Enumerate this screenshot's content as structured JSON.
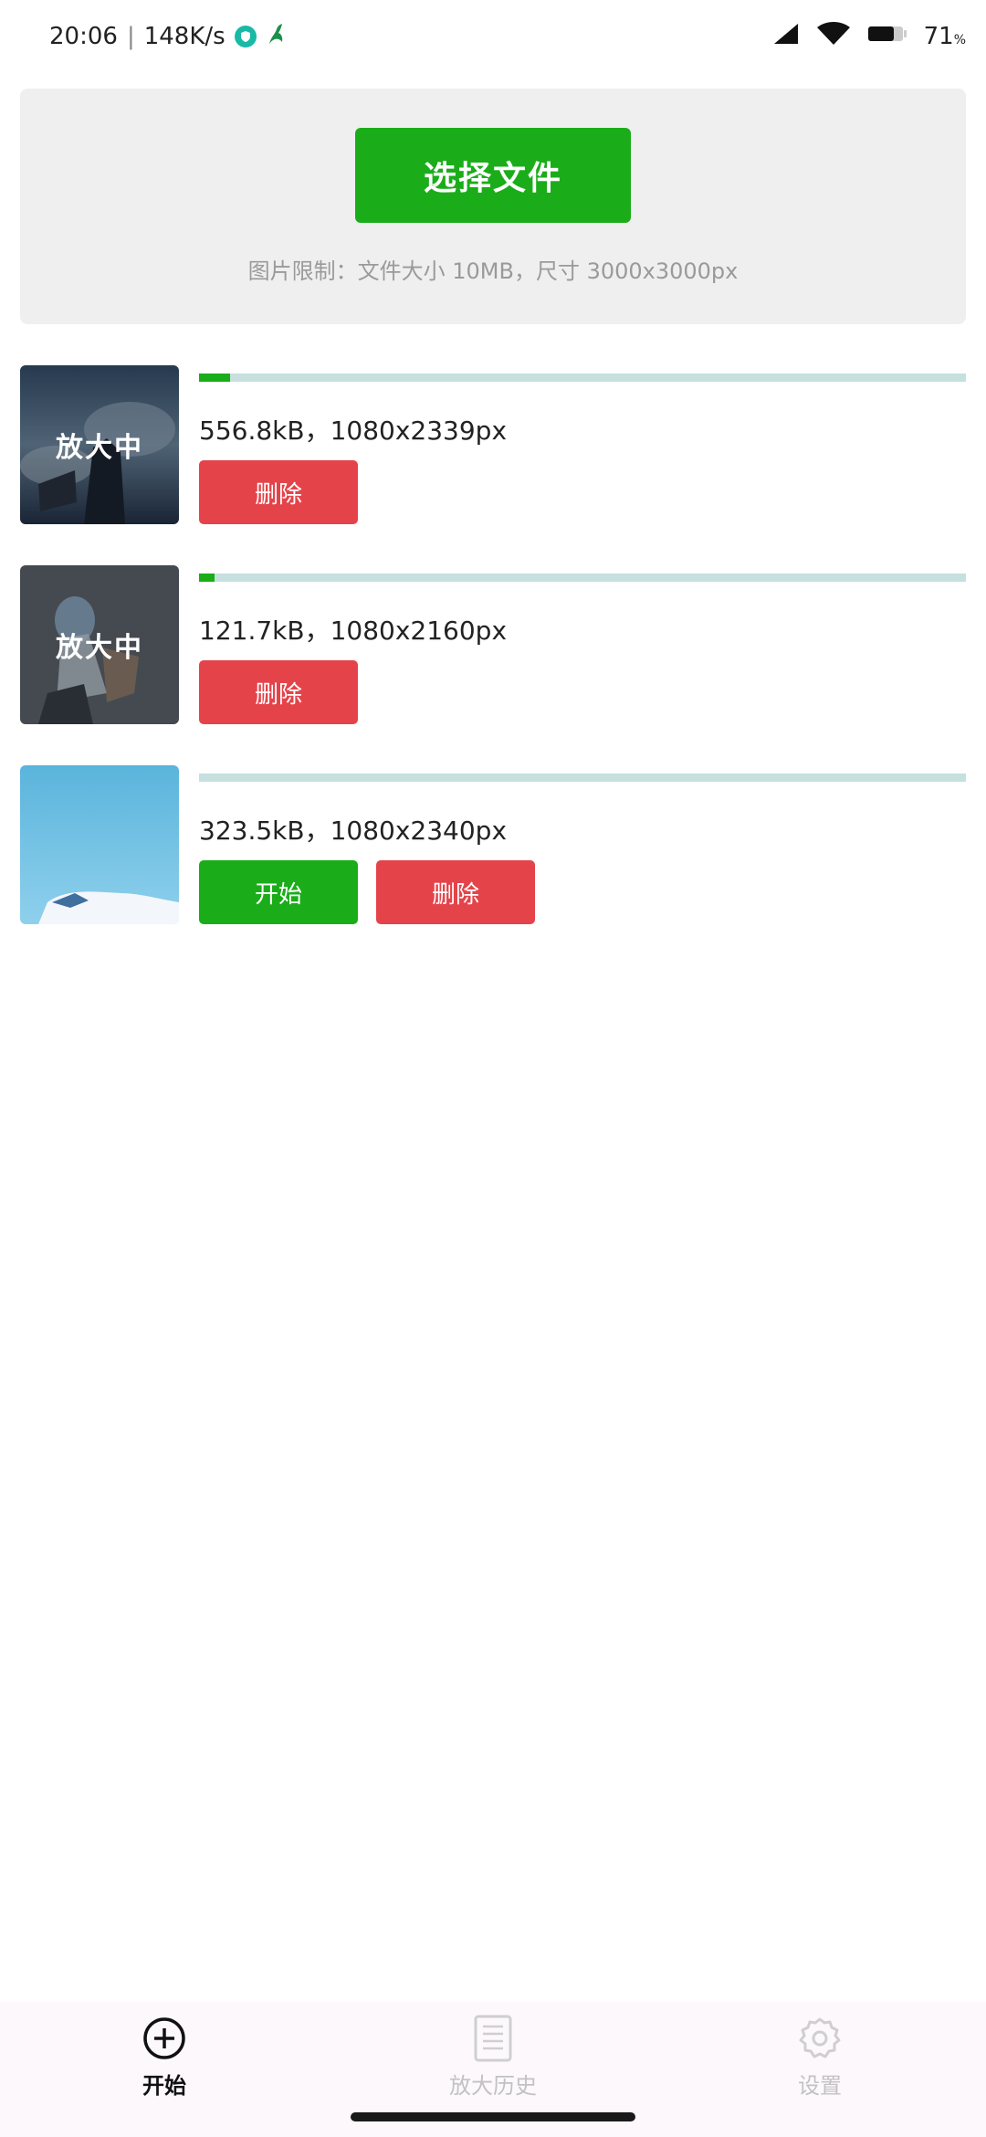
{
  "status_bar": {
    "time": "20:06",
    "net_speed": "148K/s",
    "battery": "71",
    "battery_unit": "%"
  },
  "upload": {
    "select_label": "选择文件",
    "limit_text": "图片限制：文件大小 10MB，尺寸 3000x3000px"
  },
  "files": [
    {
      "overlay": "放大中",
      "progress": 0.04,
      "info": "556.8kB，1080x2339px",
      "delete_label": "删除"
    },
    {
      "overlay": "放大中",
      "progress": 0.02,
      "info": "121.7kB，1080x2160px",
      "delete_label": "删除"
    },
    {
      "progress": 0,
      "info": "323.5kB，1080x2340px",
      "start_label": "开始",
      "delete_label": "删除"
    }
  ],
  "nav": {
    "start": "开始",
    "history": "放大历史",
    "settings": "设置"
  },
  "colors": {
    "accent_green": "#1aad19",
    "danger_red": "#e5434a",
    "progress_track": "#c5e0df"
  },
  "icons": {
    "start": "plus-circle-icon",
    "history": "document-list-icon",
    "settings": "gear-icon"
  }
}
